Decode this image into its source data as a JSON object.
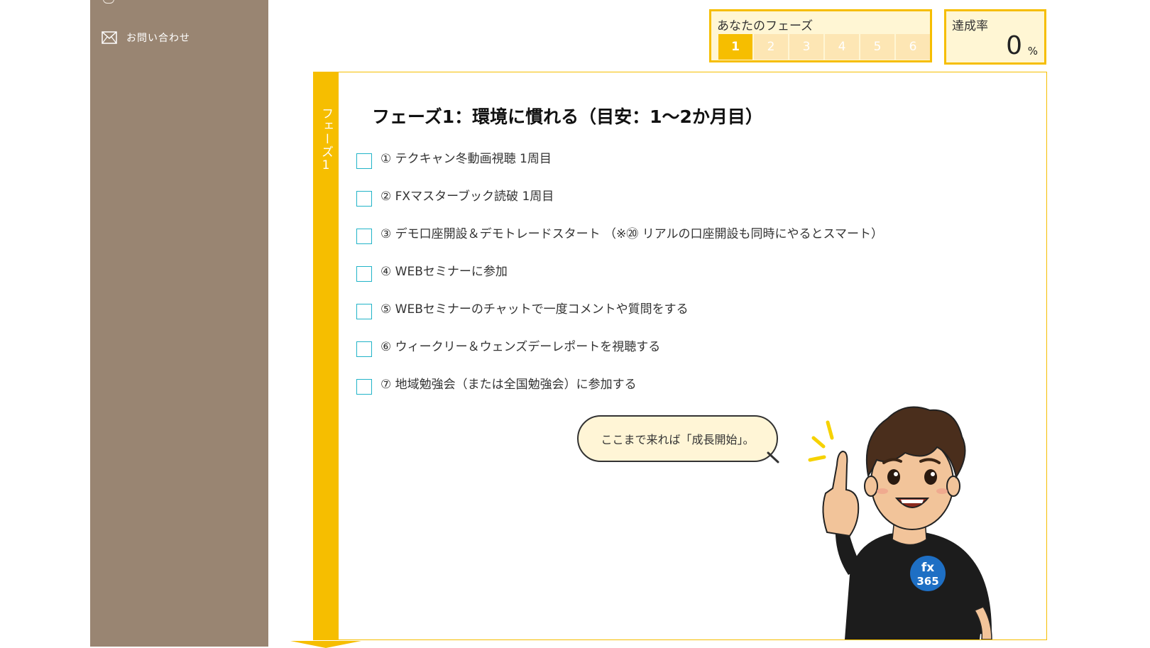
{
  "sidebar": {
    "contact_label": "お問い合わせ"
  },
  "phase_indicator": {
    "label": "あなたのフェーズ",
    "steps": [
      "1",
      "2",
      "3",
      "4",
      "5",
      "6"
    ],
    "active_step": "1"
  },
  "achievement": {
    "label": "達成率",
    "value": "0",
    "unit": "%"
  },
  "panel": {
    "tab_label": "フェーズ1",
    "title": "フェーズ1：環境に慣れる（目安：1〜2か月目）",
    "tasks": [
      {
        "label": "① テクキャン冬動画視聴 1周目",
        "checked": false
      },
      {
        "label": "② FXマスターブック読破 1周目",
        "checked": false
      },
      {
        "label": "③ デモ口座開設＆デモトレードスタート （※⑳ リアルの口座開設も同時にやるとスマート）",
        "checked": false
      },
      {
        "label": "④ WEBセミナーに参加",
        "checked": false
      },
      {
        "label": "⑤ WEBセミナーのチャットで一度コメントや質問をする",
        "checked": false
      },
      {
        "label": "⑥ ウィークリー＆ウェンズデーレポートを視聴する",
        "checked": false
      },
      {
        "label": "⑦ 地域勉強会（または全国勉強会）に参加する",
        "checked": false
      }
    ],
    "speech_bubble": "ここまで来れば「成長開始」。",
    "mascot_badge_top": "fx",
    "mascot_badge_bottom": "365"
  },
  "colors": {
    "accent": "#f6be00",
    "accent_light": "#fff6d4",
    "sidebar_bg": "#998572",
    "checkbox_border": "#22b4c8"
  }
}
